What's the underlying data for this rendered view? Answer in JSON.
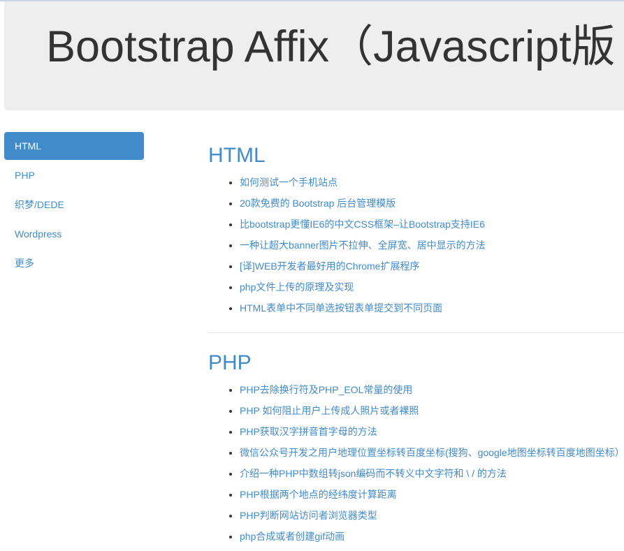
{
  "header": {
    "title": "Bootstrap Affix（Javascript版"
  },
  "sidebar": {
    "items": [
      {
        "label": "HTML"
      },
      {
        "label": "PHP"
      },
      {
        "label": "织梦/DEDE"
      },
      {
        "label": "Wordpress"
      },
      {
        "label": "更多"
      }
    ]
  },
  "sections": [
    {
      "title": "HTML",
      "links": [
        "如何测试一个手机站点",
        "20款免费的 Bootstrap 后台管理模版",
        "比bootstrap更懂IE6的中文CSS框架–让Bootstrap支持IE6",
        "一种让超大banner图片不拉伸、全屏宽、居中显示的方法",
        "[译]WEB开发者最好用的Chrome扩展程序",
        "php文件上传的原理及实现",
        "HTML表单中不同单选按钮表单提交到不同页面"
      ]
    },
    {
      "title": "PHP",
      "links": [
        "PHP去除换行符及PHP_EOL常量的使用",
        "PHP 如何阻止用户上传成人照片或者裸照",
        "PHP获取汉字拼音首字母的方法",
        "微信公众号开发之用户地理位置坐标转百度坐标(搜狗、google地图坐标转百度地图坐标）",
        "介绍一种PHP中数组转json编码而不转义中文字符和 \\ / 的方法",
        "PHP根据两个地点的经纬度计算距离",
        "PHP判断网站访问者浏览器类型",
        "php合成或者创建gif动画"
      ]
    }
  ],
  "colors": {
    "accent": "#428bca",
    "jumbotron_bg": "#eeeeee"
  }
}
